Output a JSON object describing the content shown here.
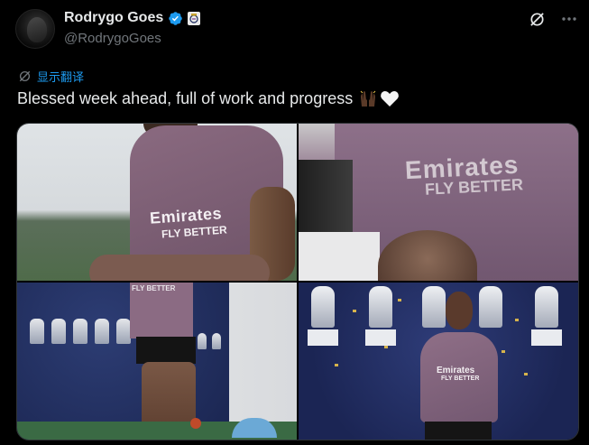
{
  "author": {
    "display_name": "Rodrygo Goes",
    "handle": "@RodrygoGoes",
    "verified_icon": "verified-badge-icon",
    "affiliate_icon": "real-madrid-crest-icon"
  },
  "header_actions": {
    "grok_icon": "grok-icon",
    "more_icon": "more-options-icon"
  },
  "translate": {
    "label": "显示翻译"
  },
  "tweet": {
    "text": "Blessed week ahead, full of work and progress",
    "emojis": [
      "raised-hands-emoji",
      "white-heart-emoji"
    ]
  },
  "media": {
    "photos": [
      {
        "desc_text": "Emirates",
        "sub_text": "FLY BETTER"
      },
      {
        "desc_text": "Emirates",
        "sub_text": "FLY BETTER"
      },
      {
        "desc_text": "",
        "sub_text": "FLY BETTER"
      },
      {
        "desc_text": "Emirates",
        "sub_text": "FLY BETTER"
      }
    ]
  },
  "colors": {
    "background": "#000000",
    "text": "#e7e9ea",
    "secondary_text": "#71767b",
    "link": "#1d9bf0",
    "border": "#2f3336"
  }
}
